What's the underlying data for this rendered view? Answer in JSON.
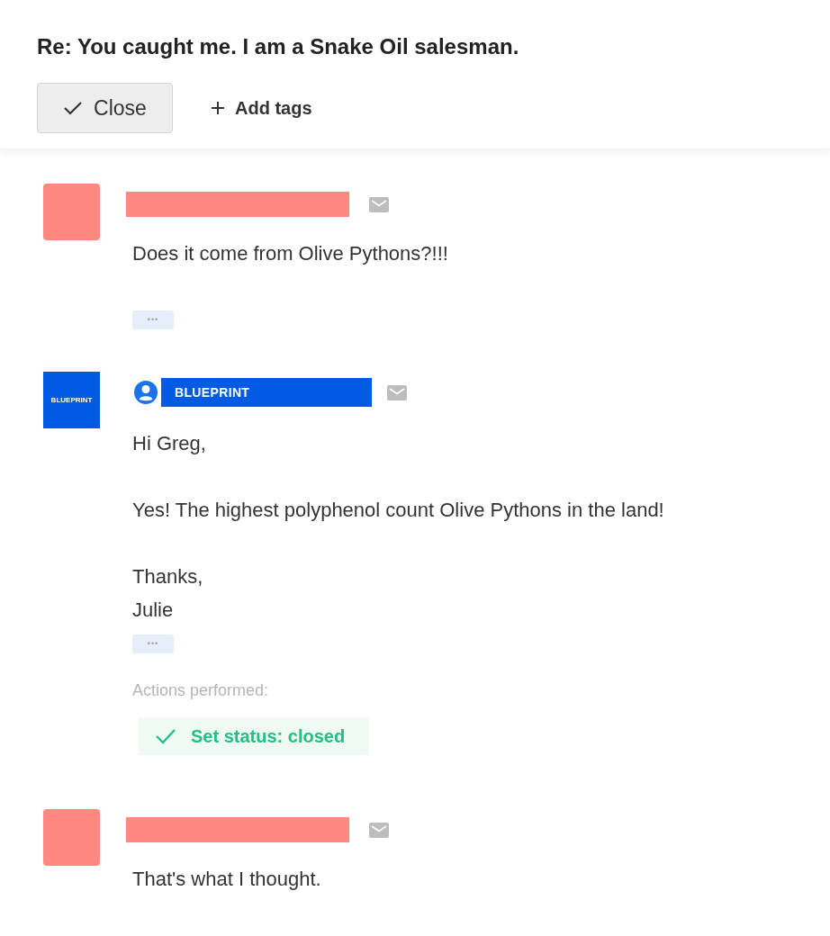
{
  "header": {
    "title": "Re: You caught me. I am a Snake Oil salesman.",
    "close_button": "Close",
    "add_tags": "Add tags"
  },
  "messages": [
    {
      "sender": {
        "kind": "redacted"
      },
      "paragraphs": [
        [
          "Does it come from Olive Pythons?!!!"
        ]
      ],
      "more": "•••"
    },
    {
      "sender": {
        "kind": "brand",
        "logo": "BLUEPRINT",
        "name": "BLUEPRINT"
      },
      "paragraphs": [
        [
          "Hi Greg,"
        ],
        [
          "Yes! The highest polyphenol count Olive Pythons in the land!"
        ],
        [
          "Thanks,",
          "Julie"
        ]
      ],
      "more": "•••",
      "actions": {
        "label": "Actions performed:",
        "items": [
          "Set status: closed"
        ]
      }
    },
    {
      "sender": {
        "kind": "redacted"
      },
      "paragraphs": [
        [
          "That's what I thought."
        ]
      ]
    }
  ]
}
